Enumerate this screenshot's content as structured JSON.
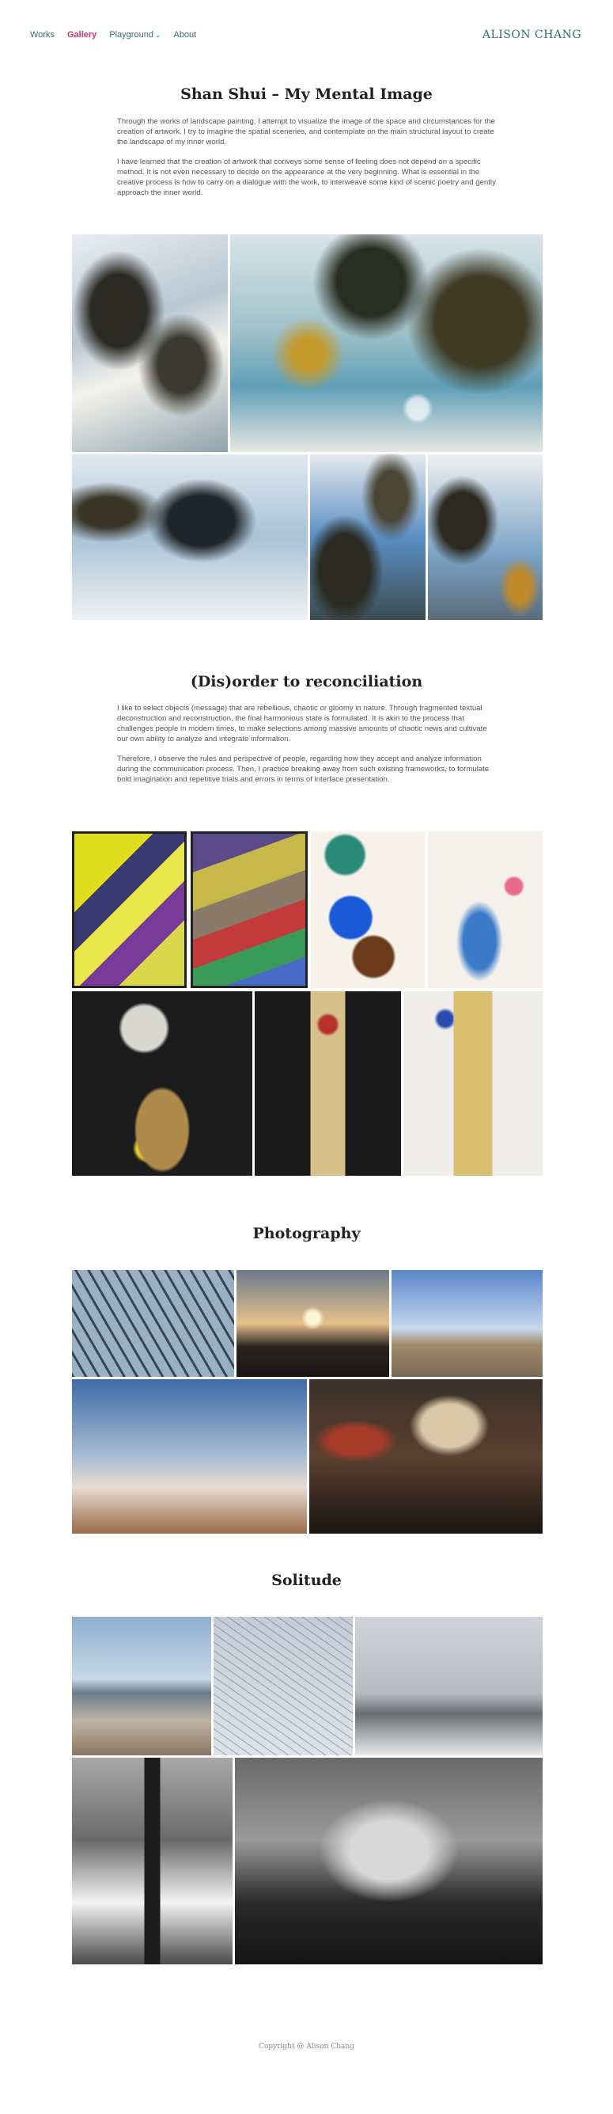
{
  "site": {
    "brand": "ALISON CHANG"
  },
  "nav": {
    "items": [
      {
        "label": "Works",
        "active": false
      },
      {
        "label": "Gallery",
        "active": true
      },
      {
        "label": "Playground",
        "active": false,
        "has_dropdown": true
      },
      {
        "label": "About",
        "active": false
      }
    ]
  },
  "sections": [
    {
      "title": "Shan Shui – My Mental Image",
      "paragraphs": [
        "Through the works of landscape painting, I attempt to visualize the image of the space and circumstances for the creation of artwork. I try to imagine the spatial sceneries, and contemplate on the main structural layout to create the landscape of my inner world.",
        "I have learned that the creation of artwork that conveys some sense of feeling does not depend on a specific method. It is not even necessary to decide on the appearance at the very beginning. What is essential in the creative process is how to carry on a dialogue with the work, to interweave some kind of scenic poetry and gently approach the inner world."
      ]
    },
    {
      "title": "(Dis)order to reconciliation",
      "paragraphs": [
        "I like to select objects (message) that are rebellious, chaotic or gloomy in nature. Through fragmented textual deconstruction and reconstruction, the final harmonious state is formulated. It is akin to the process that challenges people in modern times, to make selections among massive amounts of chaotic news and cultivate our own ability to analyze and integrate information.",
        "Therefore, I observe the rules and perspective of people, regarding how they accept and analyze information during the communication process. Then, I practice breaking away from such existing frameworks, to formulate bold imagination and repetitive trials and errors in terms of interface presentation."
      ]
    },
    {
      "title": "Photography"
    },
    {
      "title": "Solitude"
    }
  ],
  "footer": {
    "copyright": "Copyright @ Alison Chang"
  },
  "colors": {
    "accent": "#d6336c",
    "nav": "#2f6f73",
    "text": "#555555"
  }
}
